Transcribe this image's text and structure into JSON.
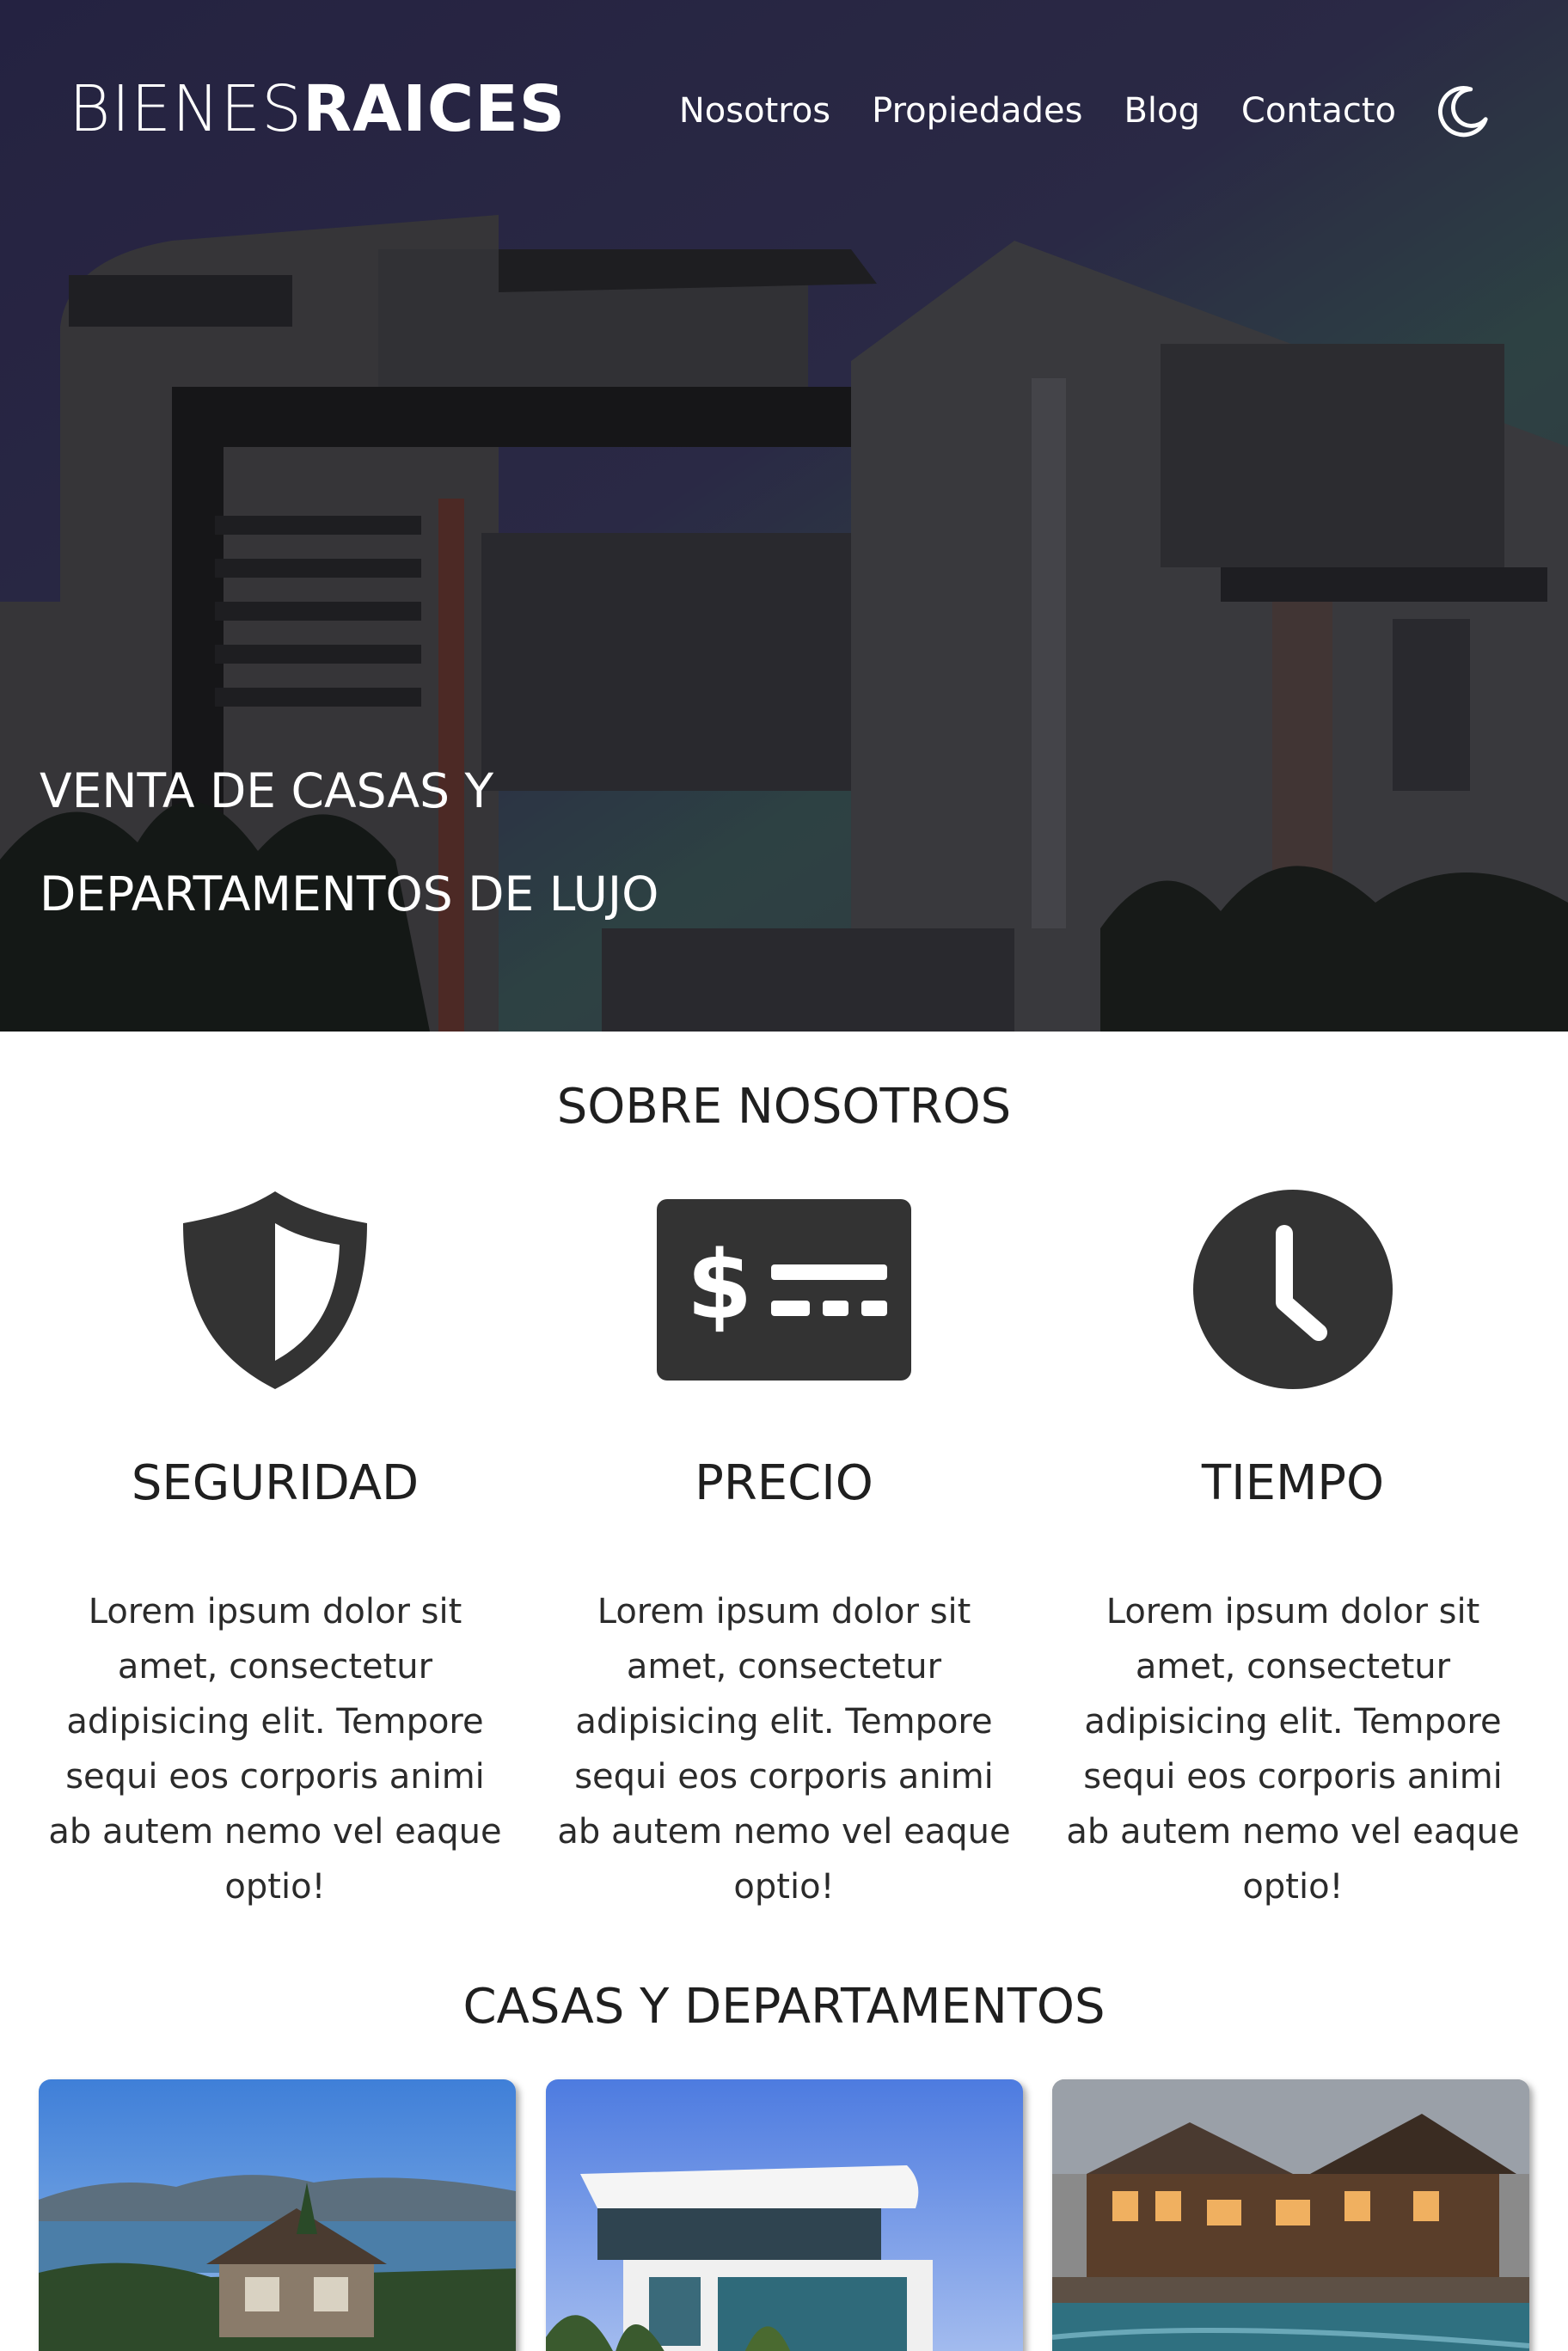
{
  "header": {
    "logo_light": "BIENES",
    "logo_bold": "RAICES",
    "nav": [
      {
        "label": "Nosotros"
      },
      {
        "label": "Propiedades"
      },
      {
        "label": "Blog"
      },
      {
        "label": "Contacto"
      }
    ],
    "theme_toggle_icon": "moon-icon"
  },
  "hero": {
    "title_line1": "VENTA DE CASAS Y",
    "title_line2": "DEPARTAMENTOS DE LUJO"
  },
  "about": {
    "title": "SOBRE NOSOTROS",
    "features": [
      {
        "icon": "shield-icon",
        "title": "SEGURIDAD",
        "text": "Lorem ipsum dolor sit amet, consectetur adipisicing elit. Tempore sequi eos corporis animi ab autem nemo vel eaque optio!"
      },
      {
        "icon": "price-tag-icon",
        "title": "PRECIO",
        "text": "Lorem ipsum dolor sit amet, consectetur adipisicing elit. Tempore sequi eos corporis animi ab autem nemo vel eaque optio!"
      },
      {
        "icon": "clock-icon",
        "title": "TIEMPO",
        "text": "Lorem ipsum dolor sit amet, consectetur adipisicing elit. Tempore sequi eos corporis animi ab autem nemo vel eaque optio!"
      }
    ]
  },
  "listings": {
    "title": "CASAS Y DEPARTAMENTOS"
  },
  "colors": {
    "icon": "#333333",
    "text": "#1f1f1f",
    "hero_sky": "#3a3a5c"
  }
}
